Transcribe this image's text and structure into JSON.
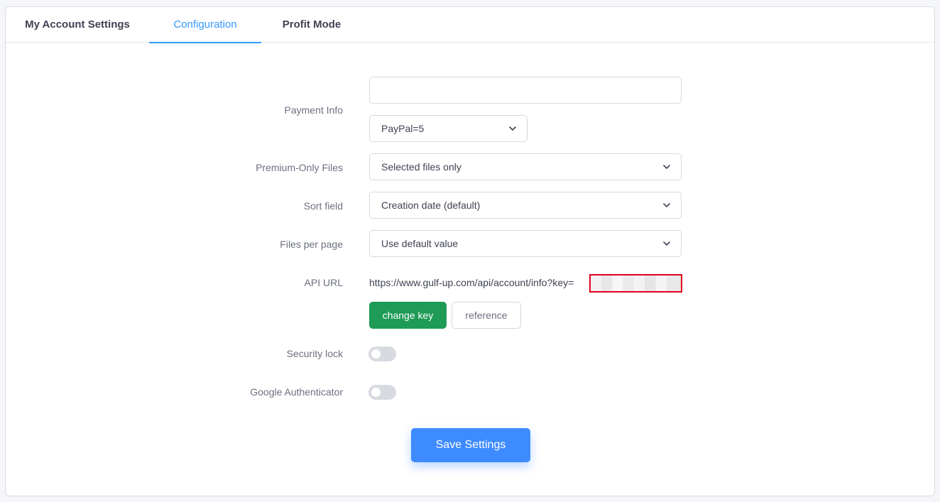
{
  "tabs": [
    {
      "label": "My Account Settings"
    },
    {
      "label": "Configuration"
    },
    {
      "label": "Profit Mode"
    }
  ],
  "payment_info": {
    "label": "Payment Info",
    "input_value": "",
    "method_selected": "PayPal=5"
  },
  "premium_files": {
    "label": "Premium-Only Files",
    "selected": "Selected files only"
  },
  "sort_field": {
    "label": "Sort field",
    "selected": "Creation date (default)"
  },
  "files_per_page": {
    "label": "Files per page",
    "selected": "Use default value"
  },
  "api": {
    "label": "API URL",
    "url": "https://www.gulf-up.com/api/account/info?key=",
    "change_key_label": "change key",
    "reference_label": "reference"
  },
  "security_lock": {
    "label": "Security lock",
    "enabled": false
  },
  "google_auth": {
    "label": "Google Authenticator",
    "enabled": false
  },
  "save_label": "Save Settings",
  "colors": {
    "accent": "#3699ff",
    "green": "#1e9b56",
    "save": "#3d8bff",
    "redacted_border": "#e3001b"
  }
}
